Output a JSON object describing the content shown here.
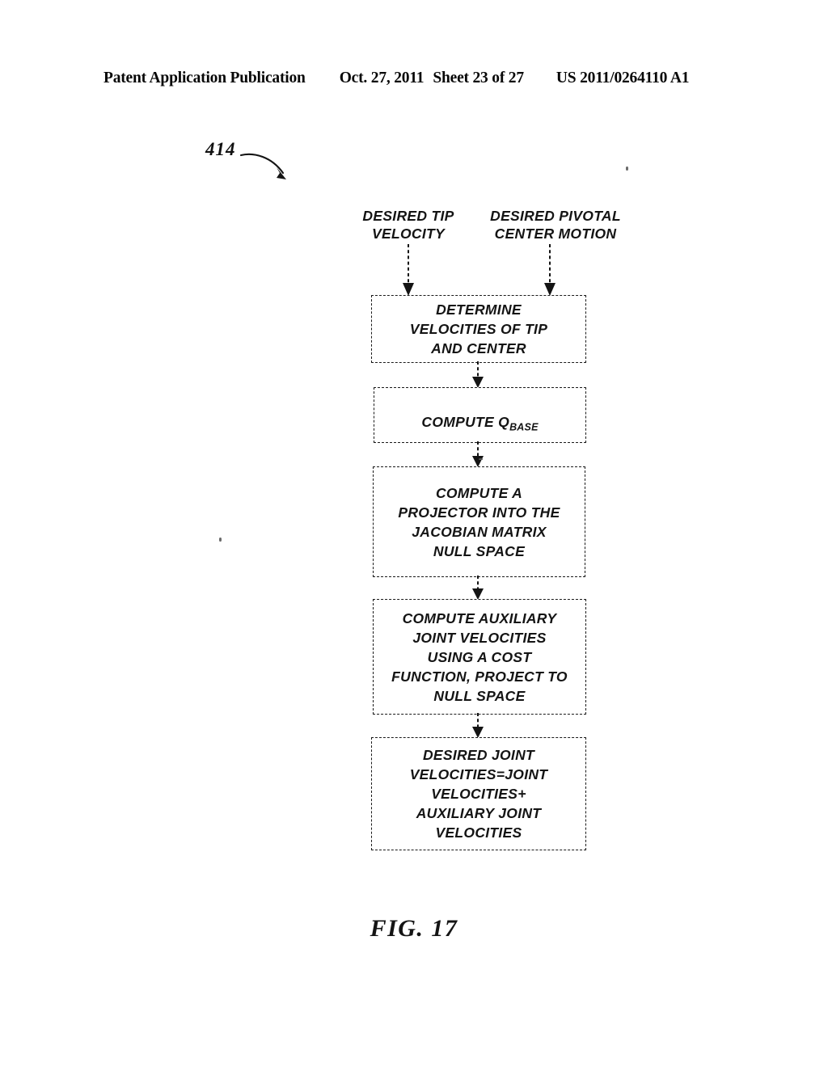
{
  "page_header": {
    "publication": "Patent Application Publication",
    "date": "Oct. 27, 2011",
    "sheet": "Sheet 23 of 27",
    "document_number": "US 2011/0264110 A1"
  },
  "figure": {
    "caption": "FIG. 17",
    "reference_numeral": "414",
    "diagram_type": "flowchart",
    "inputs": [
      {
        "id": "desired-tip-velocity",
        "label": "DESIRED TIP\nVELOCITY"
      },
      {
        "id": "desired-pivotal-center-motion",
        "label": "DESIRED PIVOTAL\nCENTER MOTION"
      }
    ],
    "nodes": [
      {
        "id": "determine-velocities",
        "label": "DETERMINE\nVELOCITIES OF TIP\nAND CENTER"
      },
      {
        "id": "compute-q-base",
        "label_prefix": "COMPUTE Q",
        "label_subscript": "BASE"
      },
      {
        "id": "compute-projector",
        "label": "COMPUTE A\nPROJECTOR INTO THE\nJACOBIAN MATRIX\nNULL SPACE"
      },
      {
        "id": "compute-auxiliary-joint-velocities",
        "label": "COMPUTE AUXILIARY\nJOINT VELOCITIES\nUSING A COST\nFUNCTION, PROJECT TO\nNULL SPACE"
      },
      {
        "id": "desired-joint-velocities",
        "label": "DESIRED JOINT\nVELOCITIES=JOINT\nVELOCITIES+\nAUXILIARY JOINT\nVELOCITIES"
      }
    ]
  },
  "colors": {
    "ink": "#141414",
    "page": "#ffffff"
  }
}
